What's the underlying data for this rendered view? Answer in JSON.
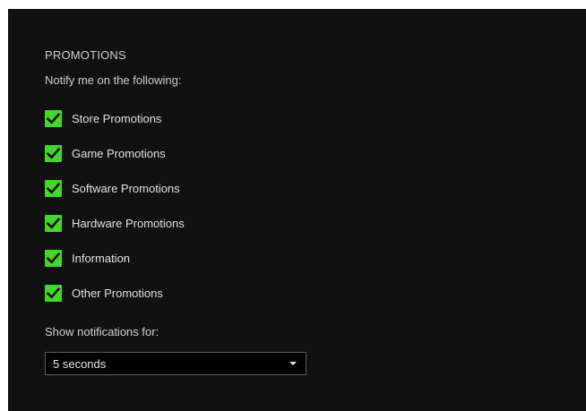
{
  "promotions": {
    "title": "PROMOTIONS",
    "subtitle": "Notify me on the following:",
    "accent_color": "#44d62c",
    "options": [
      {
        "label": "Store Promotions",
        "checked": true
      },
      {
        "label": "Game Promotions",
        "checked": true
      },
      {
        "label": "Software Promotions",
        "checked": true
      },
      {
        "label": "Hardware Promotions",
        "checked": true
      },
      {
        "label": "Information",
        "checked": true
      },
      {
        "label": "Other Promotions",
        "checked": true
      }
    ]
  },
  "notifications": {
    "label": "Show notifications for:",
    "selected": "5 seconds",
    "icon": "chevron-down-icon"
  }
}
